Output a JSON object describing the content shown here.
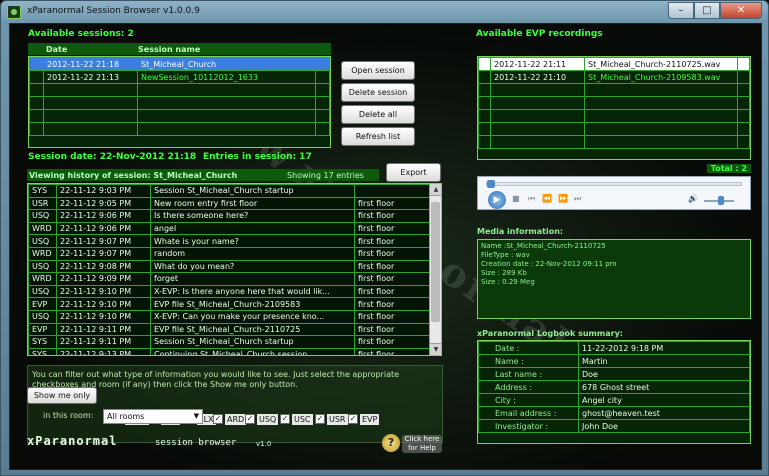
{
  "window": {
    "title": "xParanormal Session Browser v1.0.0.9",
    "minimize": "–",
    "maximize": "□",
    "close": "✕"
  },
  "sessions": {
    "header": "Available sessions: 2",
    "columns": [
      "Date",
      "Session name"
    ],
    "rows": [
      [
        "2012-11-22 21:18",
        "St_Micheal_Church"
      ],
      [
        "2012-11-22 21:13",
        "NewSession_10112012_1633"
      ]
    ]
  },
  "buttons": {
    "open": "Open session",
    "delete": "Delete session",
    "delete_all": "Delete all sessions",
    "refresh": "Refresh list",
    "export": "Export"
  },
  "session_info": {
    "label": "Session date: 22-Nov-2012 21:18",
    "entries": "Entries in session: 17"
  },
  "history": {
    "title": "Viewing history of session: St_Micheal_Church",
    "showing": "Showing 17 entries",
    "rows": [
      [
        "SYS",
        "22-11-12 9:03 PM",
        "Session St_Micheal_Church startup",
        ""
      ],
      [
        "USR",
        "22-11-12 9:05 PM",
        "New room entry first floor",
        "first floor"
      ],
      [
        "USQ",
        "22-11-12 9:06 PM",
        "Is there someone here?",
        "first floor"
      ],
      [
        "WRD",
        "22-11-12 9:06 PM",
        "angel",
        "first floor"
      ],
      [
        "USQ",
        "22-11-12 9:07 PM",
        "Whate is your name?",
        "first floor"
      ],
      [
        "WRD",
        "22-11-12 9:07 PM",
        "random",
        "first floor"
      ],
      [
        "USQ",
        "22-11-12 9:08 PM",
        "What do you mean?",
        "first floor"
      ],
      [
        "WRD",
        "22-11-12 9:09 PM",
        "forget",
        "first floor"
      ],
      [
        "USQ",
        "22-11-12 9:10 PM",
        "X-EVP: Is there anyone here that would lik...",
        "first floor"
      ],
      [
        "EVP",
        "22-11-12 9:10 PM",
        "EVP file St_Micheal_Church-2109583",
        "first floor"
      ],
      [
        "USQ",
        "22-11-12 9:10 PM",
        "X-EVP: Can you make your presence kno...",
        "first floor"
      ],
      [
        "EVP",
        "22-11-12 9:11 PM",
        "EVP file St_Micheal_Church-2110725",
        "first floor"
      ],
      [
        "SYS",
        "22-11-12 9:11 PM",
        "Session St_Micheal_Church startup",
        "first floor"
      ],
      [
        "SYS",
        "22-11-12 9:13 PM",
        "Continuing St_Micheal_Church session",
        "first floor"
      ]
    ]
  },
  "filter": {
    "description": "You can filter out what type of information you would like to see. Just select the appropriate checkboxes and room (if any) then click the Show me only button.",
    "show_button": "Show me only",
    "checkboxes": [
      "WRD",
      "SYS",
      "FLX",
      "ARD",
      "USQ",
      "USC",
      "USR",
      "EVP"
    ],
    "check_mark": "✓",
    "room_label": "in this room:",
    "room_value": "All rooms"
  },
  "evp": {
    "header": "Available EVP recordings",
    "rows": [
      [
        "2012-11-22 21:11",
        "St_Micheal_Church-2110725.wav"
      ],
      [
        "2012-11-22 21:10",
        "St_Micheal_Church-2109583.wav"
      ]
    ],
    "total": "Total : 2"
  },
  "media": {
    "header": "Media information:",
    "lines": [
      "Name :St_Micheal_Church-2110725",
      "FileType : wav",
      "Creation date : 22-Nov-2012 09:11 pm",
      "Size : 289 Kb",
      "Size : 0.29 Meg"
    ]
  },
  "logbook": {
    "header": "xParanormal Logbook summary:",
    "rows": [
      [
        "Date :",
        "11-22-2012 9:18 PM"
      ],
      [
        "Name :",
        "Martin"
      ],
      [
        "Last name :",
        "Doe"
      ],
      [
        "Address :",
        "678 Ghost street"
      ],
      [
        "City :",
        "Angel city"
      ],
      [
        "Email address :",
        "ghost@heaven.test"
      ],
      [
        "Investigator :",
        "John Doe"
      ]
    ]
  },
  "branding": {
    "logo": "xParanormal",
    "sub": "session browser",
    "version": "v1.0"
  },
  "help": {
    "label": "Click here for Help",
    "glyph": "?"
  },
  "watermark": "www.xparanormal.com"
}
